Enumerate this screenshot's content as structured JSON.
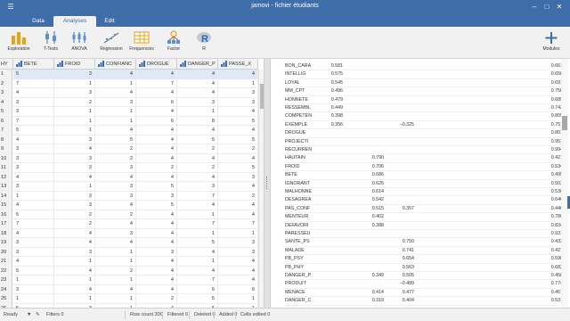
{
  "window": {
    "title": "jamovi - fichier étudiants",
    "menu_icon": "hamburger-icon",
    "buttons": [
      "minimize",
      "maximize",
      "close"
    ]
  },
  "tabs": [
    "Data",
    "Analyses",
    "Edit"
  ],
  "active_tab": "Analyses",
  "ribbon": {
    "items": [
      {
        "label": "Exploration",
        "icon": "exploration-icon"
      },
      {
        "label": "T-Tests",
        "icon": "t-tests-icon"
      },
      {
        "label": "ANOVA",
        "icon": "anova-icon"
      },
      {
        "label": "Regression",
        "icon": "regression-icon"
      },
      {
        "label": "Frequencies",
        "icon": "frequencies-icon"
      },
      {
        "label": "Factor",
        "icon": "factor-icon"
      },
      {
        "label": "R",
        "icon": "r-icon"
      }
    ],
    "modules": {
      "label": "Modules",
      "icon": "plus-icon"
    }
  },
  "grid": {
    "columns": [
      "HY",
      "BETE",
      "FROID",
      "CONFIANC",
      "DROGUE",
      "DANGER_P",
      "PASSE_X"
    ],
    "rows": [
      [
        "1",
        "5",
        "3",
        "4",
        "4",
        "4",
        "4"
      ],
      [
        "2",
        "7",
        "1",
        "1",
        "7",
        "4",
        "1"
      ],
      [
        "3",
        "4",
        "3",
        "4",
        "4",
        "4",
        "3"
      ],
      [
        "4",
        "3",
        "2",
        "3",
        "6",
        "3",
        "3"
      ],
      [
        "5",
        "3",
        "1",
        "1",
        "4",
        "1",
        "4"
      ],
      [
        "6",
        "7",
        "1",
        "1",
        "6",
        "8",
        "5"
      ],
      [
        "7",
        "5",
        "1",
        "4",
        "4",
        "4",
        "4"
      ],
      [
        "8",
        "4",
        "3",
        "5",
        "4",
        "5",
        "5"
      ],
      [
        "9",
        "3",
        "4",
        "2",
        "4",
        "2",
        "2"
      ],
      [
        "10",
        "3",
        "3",
        "2",
        "4",
        "4",
        "4"
      ],
      [
        "11",
        "3",
        "3",
        "3",
        "2",
        "2",
        "5"
      ],
      [
        "12",
        "4",
        "4",
        "4",
        "4",
        "4",
        "3"
      ],
      [
        "13",
        "3",
        "1",
        "3",
        "5",
        "3",
        "4"
      ],
      [
        "14",
        "1",
        "3",
        "3",
        "3",
        "7",
        "2"
      ],
      [
        "15",
        "4",
        "3",
        "4",
        "5",
        "4",
        "4"
      ],
      [
        "16",
        "5",
        "2",
        "2",
        "4",
        "1",
        "4"
      ],
      [
        "17",
        "7",
        "2",
        "4",
        "4",
        "7",
        "7"
      ],
      [
        "18",
        "4",
        "4",
        "3",
        "4",
        "1",
        "1"
      ],
      [
        "19",
        "3",
        "4",
        "4",
        "4",
        "5",
        "3"
      ],
      [
        "20",
        "3",
        "3",
        "1",
        "3",
        "4",
        "3"
      ],
      [
        "21",
        "4",
        "1",
        "1",
        "4",
        "1",
        "4"
      ],
      [
        "22",
        "5",
        "4",
        "2",
        "4",
        "4",
        "4"
      ],
      [
        "23",
        "1",
        "1",
        "1",
        "4",
        "7",
        "4"
      ],
      [
        "24",
        "3",
        "4",
        "4",
        "4",
        "6",
        "6"
      ],
      [
        "25",
        "1",
        "1",
        "1",
        "2",
        "5",
        "1"
      ],
      [
        "26",
        "5",
        "3",
        "1",
        "4",
        "5",
        "1"
      ]
    ]
  },
  "results": {
    "rows": [
      {
        "v": "BON_CARA",
        "c1": "0.581",
        "c2": "",
        "c3": "",
        "u": "0.661"
      },
      {
        "v": "INTELLIG",
        "c1": "0.575",
        "c2": "",
        "c3": "",
        "u": "0.656"
      },
      {
        "v": "LOYAL",
        "c1": "0.545",
        "c2": "",
        "c3": "",
        "u": "0.691"
      },
      {
        "v": "MM_CPT",
        "c1": "0.496",
        "c2": "",
        "c3": "",
        "u": "0.758"
      },
      {
        "v": "HONNETE",
        "c1": "0.479",
        "c2": "",
        "c3": "",
        "u": "0.689"
      },
      {
        "v": "RESSEMBL",
        "c1": "0.449",
        "c2": "",
        "c3": "",
        "u": "0.743"
      },
      {
        "v": "COMPETEN",
        "c1": "0.398",
        "c2": "",
        "c3": "",
        "u": "0.805"
      },
      {
        "v": "EXEMPLE",
        "c1": "0.356",
        "c2": "",
        "c3": "−0.325",
        "u": "0.757"
      },
      {
        "v": "DROGUE",
        "c1": "",
        "c2": "",
        "c3": "",
        "u": "0.801"
      },
      {
        "v": "PROJECTI",
        "c1": "",
        "c2": "",
        "c3": "",
        "u": "0.951"
      },
      {
        "v": "RECURREN",
        "c1": "",
        "c2": "",
        "c3": "",
        "u": "0.994"
      },
      {
        "v": "HAUTAIN",
        "c1": "",
        "c2": "0.790",
        "c3": "",
        "u": "0.421"
      },
      {
        "v": "FROID",
        "c1": "",
        "c2": "0.706",
        "c3": "",
        "u": "0.534"
      },
      {
        "v": "BETE",
        "c1": "",
        "c2": "0.686",
        "c3": "",
        "u": "0.495"
      },
      {
        "v": "IGNORANT",
        "c1": "",
        "c2": "0.625",
        "c3": "",
        "u": "0.503"
      },
      {
        "v": "MALHONNE",
        "c1": "",
        "c2": "0.614",
        "c3": "",
        "u": "0.538"
      },
      {
        "v": "DESAGREA",
        "c1": "",
        "c2": "0.542",
        "c3": "",
        "u": "0.646"
      },
      {
        "v": "PAS_CONF",
        "c1": "",
        "c2": "0.515",
        "c3": "0.357",
        "u": "0.446"
      },
      {
        "v": "MENTEUR",
        "c1": "",
        "c2": "0.402",
        "c3": "",
        "u": "0.780"
      },
      {
        "v": "DEFAVORI",
        "c1": "",
        "c2": "0.388",
        "c3": "",
        "u": "0.834"
      },
      {
        "v": "PARESSEU",
        "c1": "",
        "c2": "",
        "c3": "",
        "u": "0.931"
      },
      {
        "v": "SANTE_PS",
        "c1": "",
        "c2": "",
        "c3": "0.750",
        "u": "0.432"
      },
      {
        "v": "MALADE",
        "c1": "",
        "c2": "",
        "c3": "0.741",
        "u": "0.421"
      },
      {
        "v": "PB_PSY",
        "c1": "",
        "c2": "",
        "c3": "0.654",
        "u": "0.598"
      },
      {
        "v": "PB_PHY",
        "c1": "",
        "c2": "",
        "c3": "0.563",
        "u": "0.682"
      },
      {
        "v": "DANGER_P",
        "c1": "",
        "c2": "0.349",
        "c3": "0.505",
        "u": "0.456"
      },
      {
        "v": "PRODUIT",
        "c1": "",
        "c2": "",
        "c3": "−0.489",
        "u": "0.774"
      },
      {
        "v": "MENACE",
        "c1": "",
        "c2": "0.414",
        "c3": "0.477",
        "u": "0.457"
      },
      {
        "v": "DANGER_C",
        "c1": "",
        "c2": "0.319",
        "c3": "0.404",
        "u": "0.531"
      }
    ]
  },
  "status": {
    "ready": "Ready",
    "filters": "Filters 0",
    "row_count": "Row count 300",
    "filtered": "Filtered 0",
    "deleted": "Deleted 0",
    "added": "Added 0",
    "cells_edited": "Cells edited 0"
  },
  "colors": {
    "titlebar": "#3e6da9",
    "ribbon": "#f1f1f1"
  }
}
